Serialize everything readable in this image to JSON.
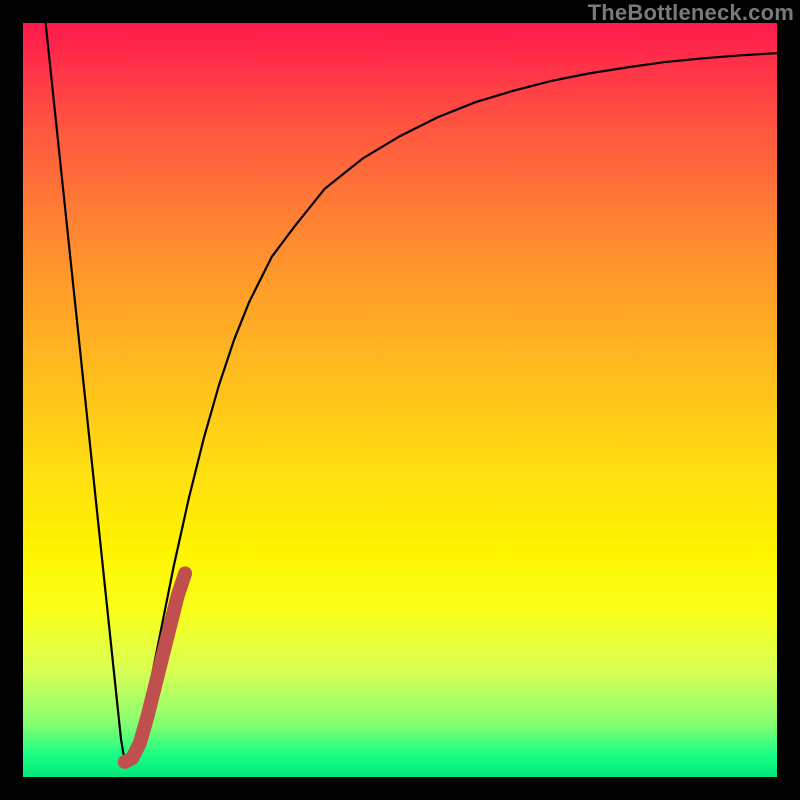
{
  "watermark": "TheBottleneck.com",
  "chart_data": {
    "type": "line",
    "title": "",
    "xlabel": "",
    "ylabel": "",
    "xlim": [
      0,
      100
    ],
    "ylim": [
      0,
      100
    ],
    "grid": false,
    "legend": false,
    "series": [
      {
        "name": "primary-curve",
        "color": "#000000",
        "x": [
          3,
          5,
          7,
          9,
          11,
          13,
          13.5,
          14,
          15,
          16,
          17,
          18,
          19,
          20,
          22,
          24,
          26,
          28,
          30,
          33,
          36,
          40,
          45,
          50,
          55,
          60,
          65,
          70,
          75,
          80,
          85,
          90,
          95,
          100
        ],
        "y": [
          100,
          81,
          62,
          43,
          24,
          5,
          2,
          2,
          4,
          8,
          13,
          18,
          23,
          28,
          37,
          45,
          52,
          58,
          63,
          69,
          73,
          78,
          82,
          85,
          87.5,
          89.5,
          91,
          92.3,
          93.3,
          94.1,
          94.8,
          95.3,
          95.7,
          96
        ]
      },
      {
        "name": "highlight-segment",
        "color": "#c0504d",
        "x": [
          13.5,
          14.5,
          15.5,
          16.5,
          17.5,
          18.5,
          19.5,
          20.5,
          21.5
        ],
        "y": [
          2,
          2.5,
          4.5,
          8,
          12,
          16,
          20,
          24,
          27
        ]
      }
    ]
  },
  "colors": {
    "background": "#000000",
    "curve": "#000000",
    "highlight": "#c0504d",
    "watermark": "#7a7a7a"
  }
}
